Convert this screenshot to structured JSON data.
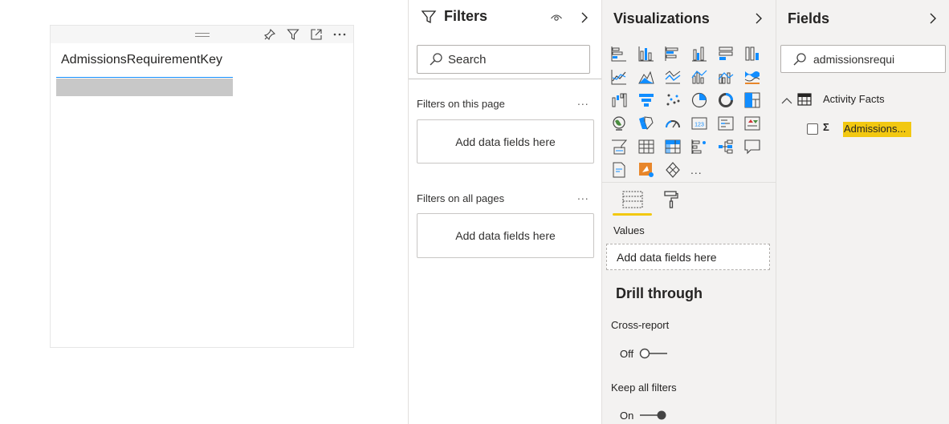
{
  "canvas": {
    "card": {
      "title": "AdmissionsRequirementKey",
      "header_icons": [
        "pin-icon",
        "filter-icon",
        "focus-mode-icon",
        "more-options-icon"
      ]
    }
  },
  "filters": {
    "title": "Filters",
    "search_placeholder": "Search",
    "page_section": {
      "label": "Filters on this page",
      "drop_text": "Add data fields here"
    },
    "all_pages_section": {
      "label": "Filters on all pages",
      "drop_text": "Add data fields here"
    },
    "more": "..."
  },
  "visualizations": {
    "title": "Visualizations",
    "more_visuals": "...",
    "values_label": "Values",
    "values_drop_text": "Add data fields here",
    "drill_through_title": "Drill through",
    "cross_report": {
      "label": "Cross-report",
      "state": "Off"
    },
    "keep_all_filters": {
      "label": "Keep all filters",
      "state": "On"
    }
  },
  "fields": {
    "title": "Fields",
    "search_value": "admissionsrequi",
    "table": {
      "name": "Activity Facts"
    },
    "field": {
      "name": "Admissions...",
      "sigma": "Σ"
    }
  },
  "colors": {
    "accent_blue": "#118dff",
    "highlight_yellow": "#f2c811",
    "pane_bg": "#f3f2f1"
  }
}
